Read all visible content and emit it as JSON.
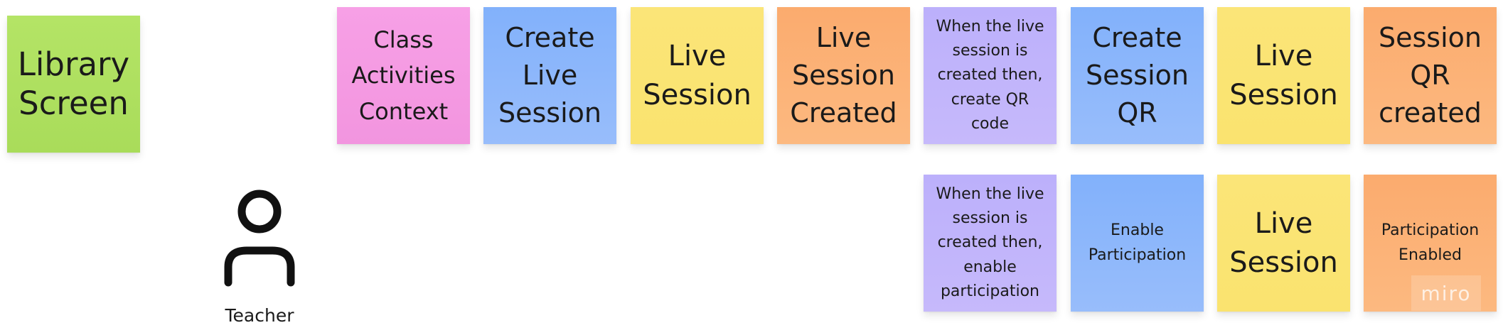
{
  "board": {
    "stickies": {
      "library_screen": {
        "text": "Library\nScreen",
        "color": "#b2e364"
      },
      "class_activities_context": {
        "text": "Class\nActivities\nContext",
        "color": "#f59ee4"
      },
      "create_live_session": {
        "text": "Create\nLive\nSession",
        "color": "#8cb6fa"
      },
      "live_session_1": {
        "text": "Live\nSession",
        "color": "#fae574"
      },
      "live_session_created": {
        "text": "Live\nSession\nCreated",
        "color": "#fbaf72"
      },
      "policy_create_qr": {
        "text": "When the live\nsession is\ncreated then,\ncreate QR\ncode",
        "color": "#c0b4fb"
      },
      "create_session_qr": {
        "text": "Create\nSession\nQR",
        "color": "#8cb6fa"
      },
      "live_session_2": {
        "text": "Live\nSession",
        "color": "#fae574"
      },
      "session_qr_created": {
        "text": "Session\nQR\ncreated",
        "color": "#fbaf72"
      },
      "policy_enable_participation": {
        "text": "When the live\nsession is\ncreated then,\nenable\nparticipation",
        "color": "#c0b4fb"
      },
      "enable_participation": {
        "text": "Enable\nParticipation",
        "color": "#8cb6fa"
      },
      "live_session_3": {
        "text": "Live\nSession",
        "color": "#fae574"
      },
      "participation_enabled": {
        "text": "Participation\nEnabled",
        "color": "#fbaf72"
      }
    },
    "actor": {
      "icon": "user-icon",
      "name": "Teacher"
    },
    "watermark": {
      "text": "miro"
    }
  }
}
